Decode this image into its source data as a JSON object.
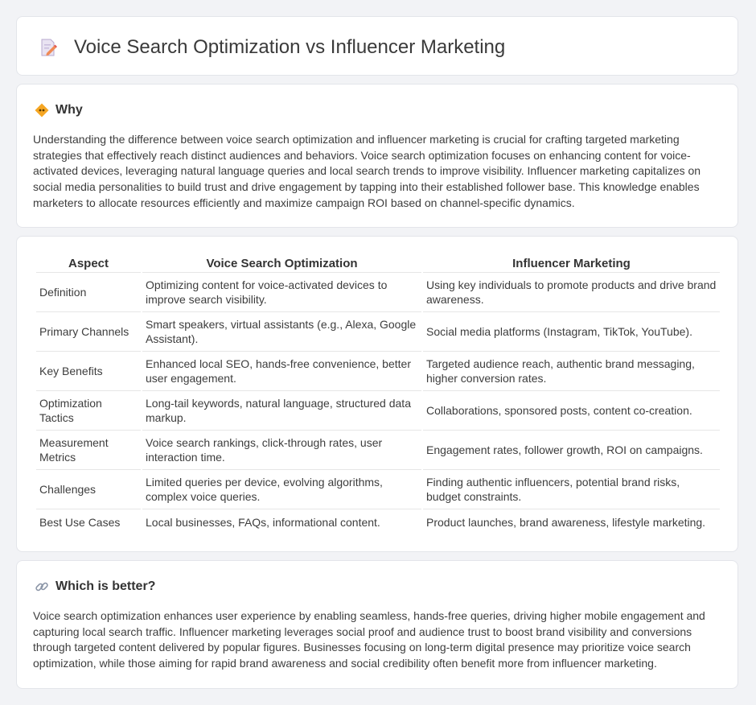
{
  "header": {
    "title": "Voice Search Optimization vs Influencer Marketing",
    "icon": "document-pencil-icon"
  },
  "why": {
    "icon": "diamond-sign-icon",
    "title": "Why",
    "body": "Understanding the difference between voice search optimization and influencer marketing is crucial for crafting targeted marketing strategies that effectively reach distinct audiences and behaviors. Voice search optimization focuses on enhancing content for voice-activated devices, leveraging natural language queries and local search trends to improve visibility. Influencer marketing capitalizes on social media personalities to build trust and drive engagement by tapping into their established follower base. This knowledge enables marketers to allocate resources efficiently and maximize campaign ROI based on channel-specific dynamics."
  },
  "table": {
    "headers": [
      "Aspect",
      "Voice Search Optimization",
      "Influencer Marketing"
    ],
    "rows": [
      [
        "Definition",
        "Optimizing content for voice-activated devices to improve search visibility.",
        "Using key individuals to promote products and drive brand awareness."
      ],
      [
        "Primary Channels",
        "Smart speakers, virtual assistants (e.g., Alexa, Google Assistant).",
        "Social media platforms (Instagram, TikTok, YouTube)."
      ],
      [
        "Key Benefits",
        "Enhanced local SEO, hands-free convenience, better user engagement.",
        "Targeted audience reach, authentic brand messaging, higher conversion rates."
      ],
      [
        "Optimization Tactics",
        "Long-tail keywords, natural language, structured data markup.",
        "Collaborations, sponsored posts, content co-creation."
      ],
      [
        "Measurement Metrics",
        "Voice search rankings, click-through rates, user interaction time.",
        "Engagement rates, follower growth, ROI on campaigns."
      ],
      [
        "Challenges",
        "Limited queries per device, evolving algorithms, complex voice queries.",
        "Finding authentic influencers, potential brand risks, budget constraints."
      ],
      [
        "Best Use Cases",
        "Local businesses, FAQs, informational content.",
        "Product launches, brand awareness, lifestyle marketing."
      ]
    ]
  },
  "better": {
    "icon": "link-icon",
    "title": "Which is better?",
    "body": "Voice search optimization enhances user experience by enabling seamless, hands-free queries, driving higher mobile engagement and capturing local search traffic. Influencer marketing leverages social proof and audience trust to boost brand visibility and conversions through targeted content delivered by popular figures. Businesses focusing on long-term digital presence may prioritize voice search optimization, while those aiming for rapid brand awareness and social credibility often benefit more from influencer marketing."
  }
}
